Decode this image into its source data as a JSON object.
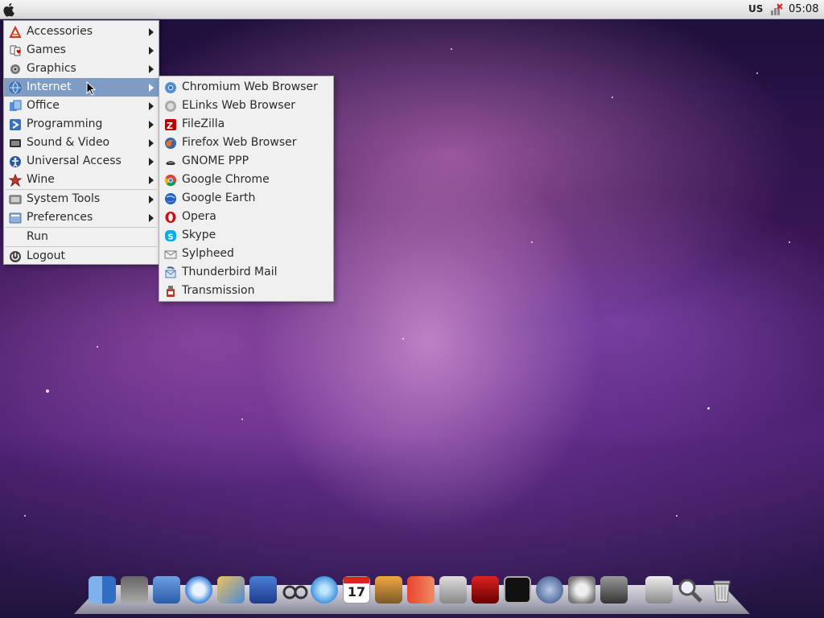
{
  "top_panel": {
    "keyboard_layout": "US",
    "clock": "05:08"
  },
  "main_menu": {
    "items": [
      {
        "label": "Accessories",
        "icon": "accessories-icon",
        "submenu": true
      },
      {
        "label": "Games",
        "icon": "games-icon",
        "submenu": true
      },
      {
        "label": "Graphics",
        "icon": "graphics-icon",
        "submenu": true
      },
      {
        "label": "Internet",
        "icon": "internet-globe-icon",
        "submenu": true,
        "active": true
      },
      {
        "label": "Office",
        "icon": "office-icon",
        "submenu": true
      },
      {
        "label": "Programming",
        "icon": "programming-icon",
        "submenu": true
      },
      {
        "label": "Sound & Video",
        "icon": "sound-video-icon",
        "submenu": true
      },
      {
        "label": "Universal Access",
        "icon": "universal-access-icon",
        "submenu": true
      },
      {
        "label": "Wine",
        "icon": "wine-icon",
        "submenu": true
      },
      {
        "label": "System Tools",
        "icon": "system-tools-icon",
        "submenu": true
      },
      {
        "label": "Preferences",
        "icon": "preferences-icon",
        "submenu": true
      },
      {
        "label": "Run",
        "icon": "",
        "submenu": false
      },
      {
        "label": "Logout",
        "icon": "logout-icon",
        "submenu": false
      }
    ]
  },
  "internet_submenu": {
    "items": [
      {
        "label": "Chromium Web Browser",
        "icon": "chromium-icon"
      },
      {
        "label": "ELinks Web Browser",
        "icon": "elinks-icon"
      },
      {
        "label": "FileZilla",
        "icon": "filezilla-icon"
      },
      {
        "label": "Firefox Web Browser",
        "icon": "firefox-icon"
      },
      {
        "label": "GNOME PPP",
        "icon": "gnome-ppp-icon"
      },
      {
        "label": "Google Chrome",
        "icon": "google-chrome-icon"
      },
      {
        "label": "Google Earth",
        "icon": "google-earth-icon"
      },
      {
        "label": "Opera",
        "icon": "opera-icon"
      },
      {
        "label": "Skype",
        "icon": "skype-icon"
      },
      {
        "label": "Sylpheed",
        "icon": "sylpheed-icon"
      },
      {
        "label": "Thunderbird Mail",
        "icon": "thunderbird-icon"
      },
      {
        "label": "Transmission",
        "icon": "transmission-icon"
      }
    ]
  },
  "dock": {
    "calendar_day": "17",
    "icons": [
      "finder-icon",
      "calculator-icon",
      "app-store-icon",
      "safari-icon",
      "photos-icon",
      "video-clapper-icon",
      "glasses-icon",
      "itunes-icon",
      "calendar-icon",
      "iphoto-icon",
      "presentation-icon",
      "preview-icon",
      "photo-booth-icon",
      "terminal-icon",
      "nvidia-icon",
      "system-preferences-icon",
      "disk-utility-icon",
      "drive-icon",
      "spotlight-icon",
      "trash-icon"
    ]
  },
  "colors": {
    "menu_highlight": "#7e9cc4",
    "menu_background": "#f0f0f0",
    "panel_background": "#e6e6e6"
  }
}
